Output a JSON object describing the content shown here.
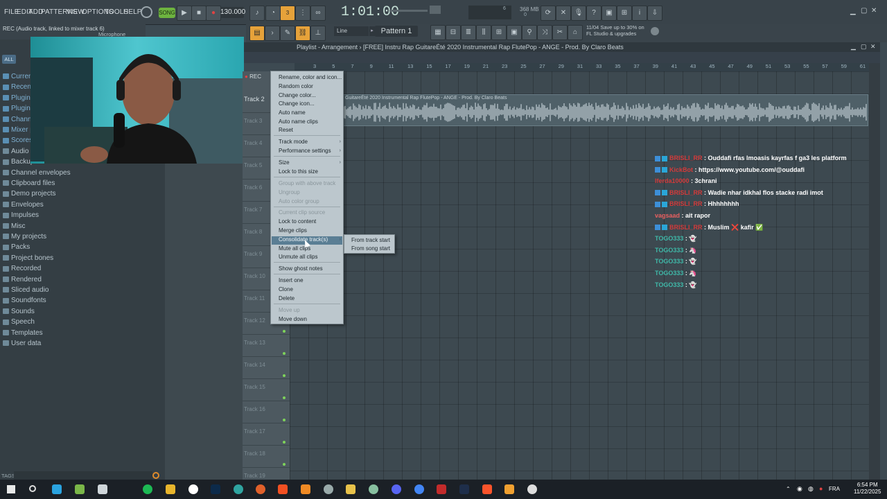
{
  "menubar": {
    "items": [
      "FILE",
      "EDIT",
      "ADD",
      "PATTERNS",
      "VIEW",
      "OPTIONS",
      "TOOLS",
      "HELP"
    ],
    "song_label": "SONG",
    "tempo": "130.000",
    "time": "1:01:00",
    "memory": "368 MB",
    "mem_small_a": "6",
    "mem_small_b": "0"
  },
  "hint": {
    "text": "REC (Audio track, linked to mixer track 6)",
    "right": "Microphone"
  },
  "toolbar2": {
    "line_label": "Line",
    "pattern_label": "Pattern 1",
    "news_date": "11/04",
    "news_line1": "Save up to 30% on",
    "news_line2": "FL Studio & upgrades"
  },
  "browser": {
    "all_label": "ALL",
    "items": [
      {
        "label": "Current project",
        "hi": true
      },
      {
        "label": "Recent files",
        "hi": true
      },
      {
        "label": "Plugin database",
        "hi": true
      },
      {
        "label": "Plugin presets",
        "hi": true
      },
      {
        "label": "Channel presets",
        "hi": true
      },
      {
        "label": "Mixer presets",
        "hi": true
      },
      {
        "label": "Scores",
        "hi": true
      },
      {
        "label": "Audio",
        "hi": false
      },
      {
        "label": "Backup",
        "hi": false
      },
      {
        "label": "Channel envelopes",
        "hi": false
      },
      {
        "label": "Clipboard files",
        "hi": false
      },
      {
        "label": "Demo projects",
        "hi": false
      },
      {
        "label": "Envelopes",
        "hi": false
      },
      {
        "label": "Impulses",
        "hi": false
      },
      {
        "label": "Misc",
        "hi": false
      },
      {
        "label": "My projects",
        "hi": false
      },
      {
        "label": "Packs",
        "hi": false
      },
      {
        "label": "Project bones",
        "hi": false
      },
      {
        "label": "Recorded",
        "hi": false
      },
      {
        "label": "Rendered",
        "hi": false
      },
      {
        "label": "Sliced audio",
        "hi": false
      },
      {
        "label": "Soundfonts",
        "hi": false
      },
      {
        "label": "Sounds",
        "hi": false
      },
      {
        "label": "Speech",
        "hi": false
      },
      {
        "label": "Templates",
        "hi": false
      },
      {
        "label": "User data",
        "hi": false
      }
    ],
    "tags_label": "TAGS"
  },
  "playlist": {
    "title": "Playlist - Arrangement › [FREE] Instru Rap GuitareÉté 2020 Instrumental Rap FlutePop - ANGE - Prod. By Claro Beats",
    "rec_label": "REC",
    "clip_label": "GuitareÉté 2020 Instrumental Rap FlutePop - ANGE - Prod. By Claro Beats",
    "ruler": [
      "3",
      "5",
      "7",
      "9",
      "11",
      "13",
      "15",
      "17",
      "19",
      "21",
      "23",
      "25",
      "27",
      "29",
      "31",
      "33",
      "35",
      "37",
      "39",
      "41",
      "43",
      "45",
      "47",
      "49",
      "51",
      "53",
      "55",
      "57",
      "59",
      "61"
    ],
    "tracks": [
      "Track 2",
      "Track 3",
      "Track 4",
      "Track 5",
      "Track 6",
      "Track 7",
      "Track 8",
      "Track 9",
      "Track 10",
      "Track 11",
      "Track 12",
      "Track 13",
      "Track 14",
      "Track 15",
      "Track 16",
      "Track 17",
      "Track 18",
      "Track 19"
    ]
  },
  "context_menu": {
    "items": [
      {
        "label": "Rename, color and icon...",
        "dis": false
      },
      {
        "label": "Random color",
        "dis": false
      },
      {
        "label": "Change color...",
        "dis": false
      },
      {
        "label": "Change icon...",
        "dis": false
      },
      {
        "label": "Auto name",
        "dis": false
      },
      {
        "label": "Auto name clips",
        "dis": false
      },
      {
        "label": "Reset",
        "dis": false
      },
      {
        "label": "Track mode",
        "dis": false,
        "sub": true
      },
      {
        "label": "Performance settings",
        "dis": false,
        "sub": true
      },
      {
        "label": "Size",
        "dis": false,
        "sub": true
      },
      {
        "label": "Lock to this size",
        "dis": false
      },
      {
        "label": "Group with above track",
        "dis": true
      },
      {
        "label": "Ungroup",
        "dis": true
      },
      {
        "label": "Auto color group",
        "dis": true
      },
      {
        "label": "Current clip source",
        "dis": true
      },
      {
        "label": "Lock to content",
        "dis": false
      },
      {
        "label": "Merge clips",
        "dis": false
      },
      {
        "label": "Consolidate track(s)",
        "dis": false,
        "sub": true,
        "hi": true
      },
      {
        "label": "Mute all clips",
        "dis": false
      },
      {
        "label": "Unmute all clips",
        "dis": false
      },
      {
        "label": "Show ghost notes",
        "dis": false
      },
      {
        "label": "Insert one",
        "dis": false
      },
      {
        "label": "Clone",
        "dis": false
      },
      {
        "label": "Delete",
        "dis": false
      },
      {
        "label": "Move up",
        "dis": true
      },
      {
        "label": "Move down",
        "dis": false
      }
    ],
    "submenu": [
      "From track start",
      "From song start"
    ]
  },
  "chat": [
    {
      "user": "BRISLI_RR",
      "color": "#d43a3a",
      "msg": "Ouddafi rfas lmoasis kayrfas f ga3 les platform",
      "badge": true
    },
    {
      "user": "KickBot",
      "color": "#d43a3a",
      "msg": "https://www.youtube.com/@ouddafi",
      "badge": true
    },
    {
      "user": "lferda10000",
      "color": "#d43a3a",
      "msg": "3chrani",
      "badge": false
    },
    {
      "user": "BRISLI_RR",
      "color": "#d43a3a",
      "msg": "Wadie nhar idkhal flos stacke radi imot",
      "badge": true
    },
    {
      "user": "BRISLI_RR",
      "color": "#d43a3a",
      "msg": "Hhhhhhhh",
      "badge": true
    },
    {
      "user": "vagsaad",
      "color": "#e86060",
      "msg": "ait rapor",
      "badge": false
    },
    {
      "user": "BRISLI_RR",
      "color": "#d43a3a",
      "msg": "Muslim ❌ kafir ✅",
      "badge": true
    },
    {
      "user": "TOGO333",
      "color": "#3fb8a8",
      "msg": "👻",
      "badge": false
    },
    {
      "user": "TOGO333",
      "color": "#3fb8a8",
      "msg": "🦄",
      "badge": false
    },
    {
      "user": "TOGO333",
      "color": "#3fb8a8",
      "msg": "👻",
      "badge": false
    },
    {
      "user": "TOGO333",
      "color": "#3fb8a8",
      "msg": "🦄",
      "badge": false
    },
    {
      "user": "TOGO333",
      "color": "#3fb8a8",
      "msg": "👻",
      "badge": false
    }
  ],
  "taskbar": {
    "time": "6:54 PM",
    "date": "11/22/2025",
    "lang": "FRA"
  }
}
